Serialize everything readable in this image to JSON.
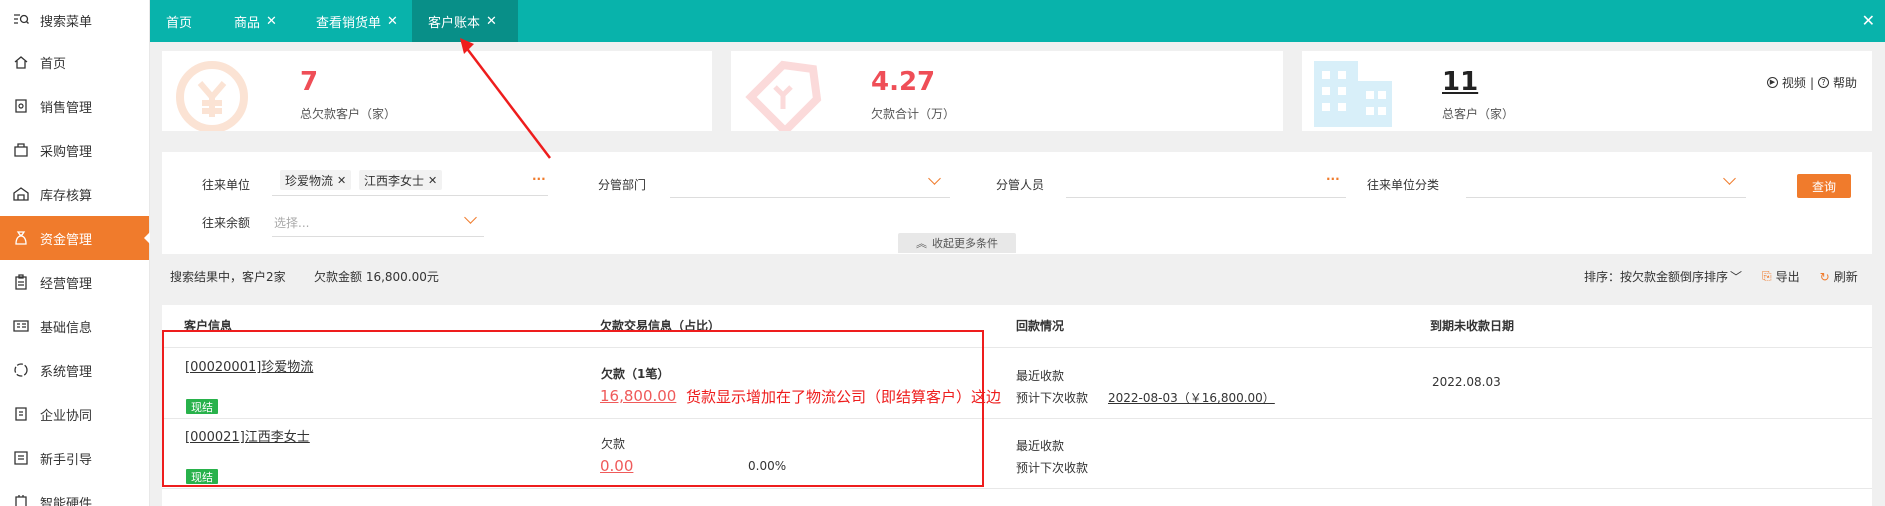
{
  "sidebar": {
    "items": [
      {
        "label": "搜索菜单",
        "icon": "search-menu-icon"
      },
      {
        "label": "首页",
        "icon": "home-icon"
      },
      {
        "label": "销售管理",
        "icon": "sales-icon"
      },
      {
        "label": "采购管理",
        "icon": "purchase-icon"
      },
      {
        "label": "库存核算",
        "icon": "warehouse-icon"
      },
      {
        "label": "资金管理",
        "icon": "money-bag-icon"
      },
      {
        "label": "经营管理",
        "icon": "clipboard-icon"
      },
      {
        "label": "基础信息",
        "icon": "info-card-icon"
      },
      {
        "label": "系统管理",
        "icon": "system-icon"
      },
      {
        "label": "企业协同",
        "icon": "collab-icon"
      },
      {
        "label": "新手引导",
        "icon": "guide-icon"
      },
      {
        "label": "智能硬件",
        "icon": "hardware-icon"
      }
    ],
    "active_index": 5
  },
  "tabs": [
    {
      "label": "首页",
      "closable": false
    },
    {
      "label": "商品",
      "closable": true
    },
    {
      "label": "查看销货单",
      "closable": true
    },
    {
      "label": "客户账本",
      "closable": true
    }
  ],
  "stats": {
    "debt_customers": {
      "value": "7",
      "label": "总欠款客户（家）"
    },
    "debt_total": {
      "value": "4.27",
      "label": "欠款合计（万）"
    },
    "total_customers": {
      "value": "11",
      "label": "总客户（家）"
    }
  },
  "help": {
    "video": "视频",
    "separator": "|",
    "help": "帮助"
  },
  "filters": {
    "partner_label": "往来单位",
    "partner_chips": [
      "珍爱物流",
      "江西李女士"
    ],
    "dept_label": "分管部门",
    "staff_label": "分管人员",
    "category_label": "往来单位分类",
    "balance_label": "往来余额",
    "balance_placeholder": "选择...",
    "query_button": "查询",
    "collapse_label": "收起更多条件"
  },
  "summary": {
    "result_text": "搜索结果中，客户2家",
    "amount_text": "欠款金额 16,800.00元",
    "sort_label": "排序：按欠款金额倒序排序",
    "export": "导出",
    "refresh": "刷新"
  },
  "table": {
    "headers": [
      "客户信息",
      "欠款交易信息（占比）",
      "回款情况",
      "到期未收款日期"
    ],
    "rows": [
      {
        "customer": "[00020001]珍爱物流",
        "tag": "现结",
        "debt_label": "欠款（1笔）",
        "amount": "16,800.00",
        "ratio": "",
        "recent": "最近收款",
        "next_label": "预计下次收款",
        "next_value": "2022-08-03（￥16,800.00）",
        "due_date": "2022.08.03"
      },
      {
        "customer": "[000021]江西李女士",
        "tag": "现结",
        "debt_label": "欠款",
        "amount": "0.00",
        "ratio": "0.00%",
        "recent": "最近收款",
        "next_label": "预计下次收款",
        "next_value": "",
        "due_date": ""
      }
    ]
  },
  "annotation": {
    "note": "货款显示增加在了物流公司（即结算客户）这边"
  },
  "colors": {
    "teal": "#08b3ab",
    "orange": "#f07b2c",
    "red": "#ee1d1d",
    "green": "#28b24b"
  }
}
